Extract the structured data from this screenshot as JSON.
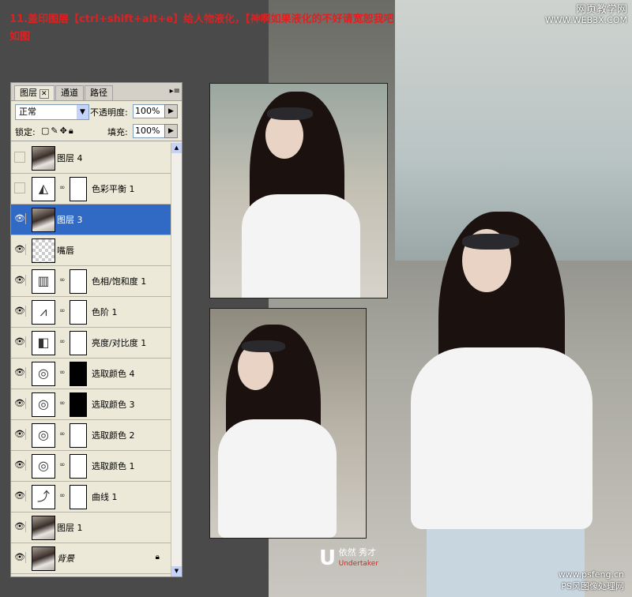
{
  "heading": {
    "line1": "11.盖印图层【ctrl+shift+alt+e】给人物液化，【神啊如果液化的不好请宽恕我吧",
    "line2": "如图"
  },
  "watermark_top": {
    "line1": "网页教学网",
    "line2": "WWW.WEB3X.COM"
  },
  "panel": {
    "tabs": [
      "图层",
      "通道",
      "路径"
    ],
    "blend_mode": "正常",
    "opacity_label": "不透明度:",
    "opacity_value": "100%",
    "lock_label": "锁定:",
    "fill_label": "填充:",
    "fill_value": "100%",
    "layers": [
      {
        "name": "图层 4",
        "visible": false,
        "thumb": "photo"
      },
      {
        "name": "色彩平衡 1",
        "visible": false,
        "thumb": "adjust-balance",
        "mask": "white"
      },
      {
        "name": "图层 3",
        "visible": true,
        "thumb": "photo",
        "selected": true
      },
      {
        "name": "嘴唇",
        "visible": true,
        "thumb": "transparent"
      },
      {
        "name": "色相/饱和度 1",
        "visible": true,
        "thumb": "adjust-huesat",
        "mask": "white"
      },
      {
        "name": "色阶 1",
        "visible": true,
        "thumb": "adjust-levels",
        "mask": "white"
      },
      {
        "name": "亮度/对比度 1",
        "visible": true,
        "thumb": "adjust-brightness",
        "mask": "white"
      },
      {
        "name": "选取颜色 4",
        "visible": true,
        "thumb": "adjust-selective",
        "mask": "black"
      },
      {
        "name": "选取颜色 3",
        "visible": true,
        "thumb": "adjust-selective",
        "mask": "black"
      },
      {
        "name": "选取颜色 2",
        "visible": true,
        "thumb": "adjust-selective",
        "mask": "white"
      },
      {
        "name": "选取颜色 1",
        "visible": true,
        "thumb": "adjust-selective",
        "mask": "white"
      },
      {
        "name": "曲线 1",
        "visible": true,
        "thumb": "adjust-curves",
        "mask": "white"
      },
      {
        "name": "图层 1",
        "visible": true,
        "thumb": "photo"
      },
      {
        "name": "背景",
        "visible": true,
        "thumb": "photo",
        "italic": true,
        "locked": true
      }
    ]
  },
  "watermark_bottom": {
    "letter": "U",
    "name": "依然 秀才",
    "sub": "Undertaker"
  },
  "watermark_br": {
    "line1": "www.psfeng.cn",
    "line2": "PS风图像处理网"
  }
}
